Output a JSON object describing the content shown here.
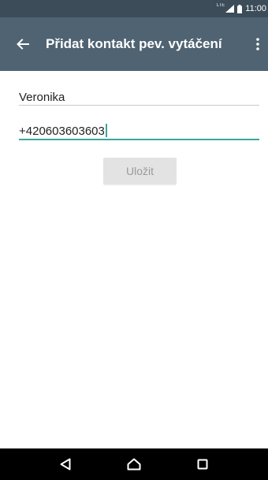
{
  "status_bar": {
    "network": "LTE",
    "time": "11:00"
  },
  "app_bar": {
    "title": "Přidat kontakt pev. vytáčení",
    "back_icon": "arrow-left-icon",
    "menu_icon": "more-vertical-icon"
  },
  "form": {
    "name_value": "Veronika",
    "phone_value": "+420603603603",
    "save_label": "Uložit"
  },
  "nav_bar": {
    "icons": [
      "back-triangle-icon",
      "home-icon",
      "recents-icon"
    ]
  },
  "colors": {
    "status_bar": "#3c4c58",
    "app_bar": "#4f6372",
    "accent": "#3aa89b",
    "save_button_bg": "#e3e3e3",
    "save_button_text": "#9a9a9a"
  }
}
